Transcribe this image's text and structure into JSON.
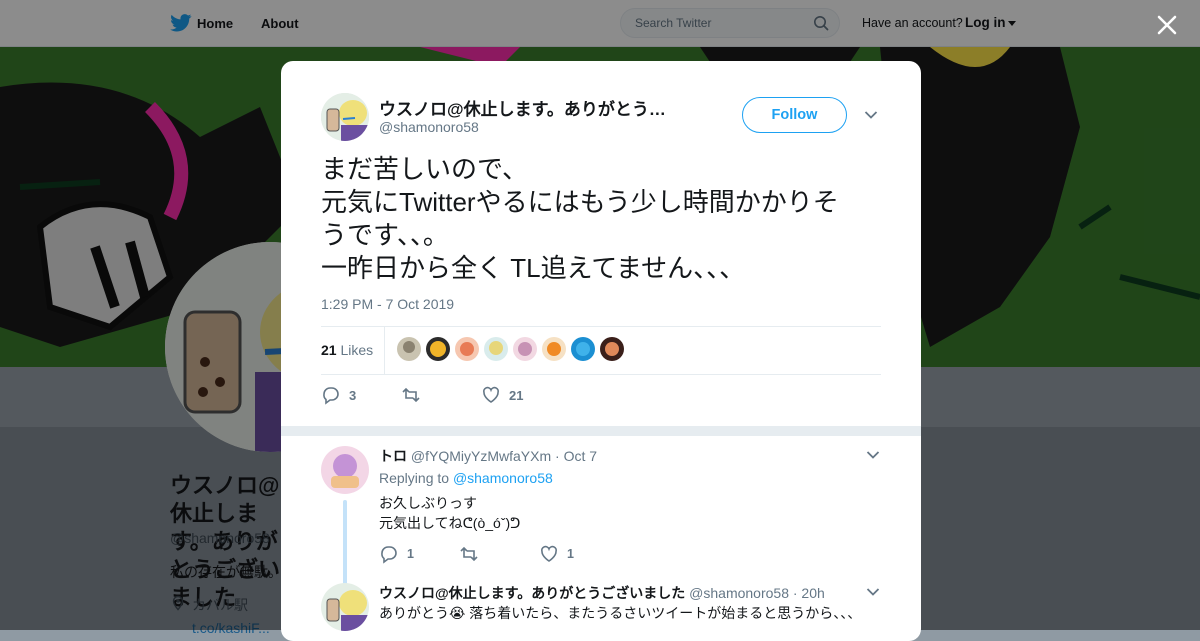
{
  "topnav": {
    "home_label": "Home",
    "about_label": "About",
    "search_placeholder": "Search Twitter",
    "have_account": "Have an account?",
    "login_label": "Log in"
  },
  "background_profile": {
    "name": "ウスノロ@休止します。ありがとうございました",
    "handle": "@shamonoro58",
    "bio": "私の存在が無駄。",
    "location": "カバル駅",
    "link": "t.co/kashiF..."
  },
  "colors": {
    "accent": "#1da1f2",
    "banner_green": "#3a7a2c"
  },
  "tweet": {
    "author_name": "ウスノロ@休止します。ありがとう…",
    "author_handle": "@shamonoro58",
    "follow_label": "Follow",
    "text_lines": [
      "まだ苦しいので、",
      "元気にTwitterやるにはもう少し時間かかりそ",
      "うです、、。",
      "一昨日から全く TL追えてません、、、"
    ],
    "timestamp": "1:29 PM - 7 Oct 2019",
    "likes_count": "21",
    "likes_label": "Likes",
    "reply_count": "3",
    "retweet_count": "",
    "like_count": "21"
  },
  "replies": [
    {
      "name": "トロ",
      "handle": "@fYQMiyYzMwfaYXm",
      "time": "· Oct 7",
      "replying_prefix": "Replying to",
      "replying_to": "@shamonoro58",
      "lines": [
        "お久しぶりっす",
        "元気出してねᕦ(ò_óˇ)ᕤ"
      ],
      "reply_count": "1",
      "like_count": "1"
    },
    {
      "name": "ウスノロ@休止します。ありがとうございました",
      "handle": "@shamonoro58",
      "time": "· 20h",
      "lines": [
        "ありがとう😭 落ち着いたら、またうるさいツイートが始まると思うから、、、"
      ]
    }
  ]
}
